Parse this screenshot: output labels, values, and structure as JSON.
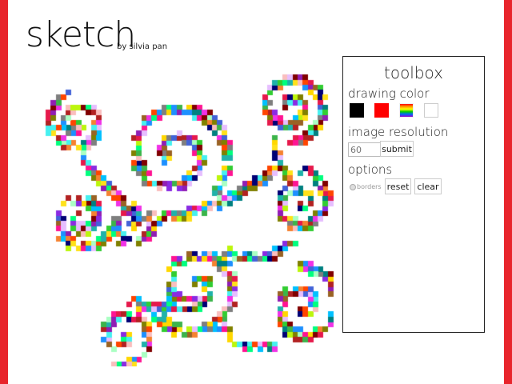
{
  "header": {
    "title": "sketch",
    "byline": "by silvia pan"
  },
  "toolbox": {
    "title": "toolbox",
    "drawing_color_label": "drawing color",
    "swatches": [
      {
        "name": "black",
        "color": "#000000"
      },
      {
        "name": "red",
        "color": "#ff0000"
      },
      {
        "name": "rainbow",
        "color": "rainbow"
      },
      {
        "name": "white",
        "color": "#ffffff"
      }
    ],
    "image_resolution_label": "image resolution",
    "resolution_placeholder": "60",
    "submit_label": "submit",
    "options_label": "options",
    "borders_label": "borders",
    "reset_label": "reset",
    "clear_label": "clear"
  },
  "colors": {
    "frame": "#e8252c",
    "palette": [
      "#e6194b",
      "#3cb44b",
      "#ffe119",
      "#4363d8",
      "#f58231",
      "#911eb4",
      "#46f0f0",
      "#f032e6",
      "#bcf60c",
      "#fabebe",
      "#008080",
      "#e6beff",
      "#9a6324",
      "#ff4500",
      "#00c0ff",
      "#800000",
      "#aaffc3",
      "#808000",
      "#000075",
      "#7f7f7f",
      "#32cd32",
      "#ff1493",
      "#1e90ff",
      "#ffd700",
      "#00ff7f",
      "#b22222",
      "#8a2be2",
      "#20b2aa"
    ]
  }
}
